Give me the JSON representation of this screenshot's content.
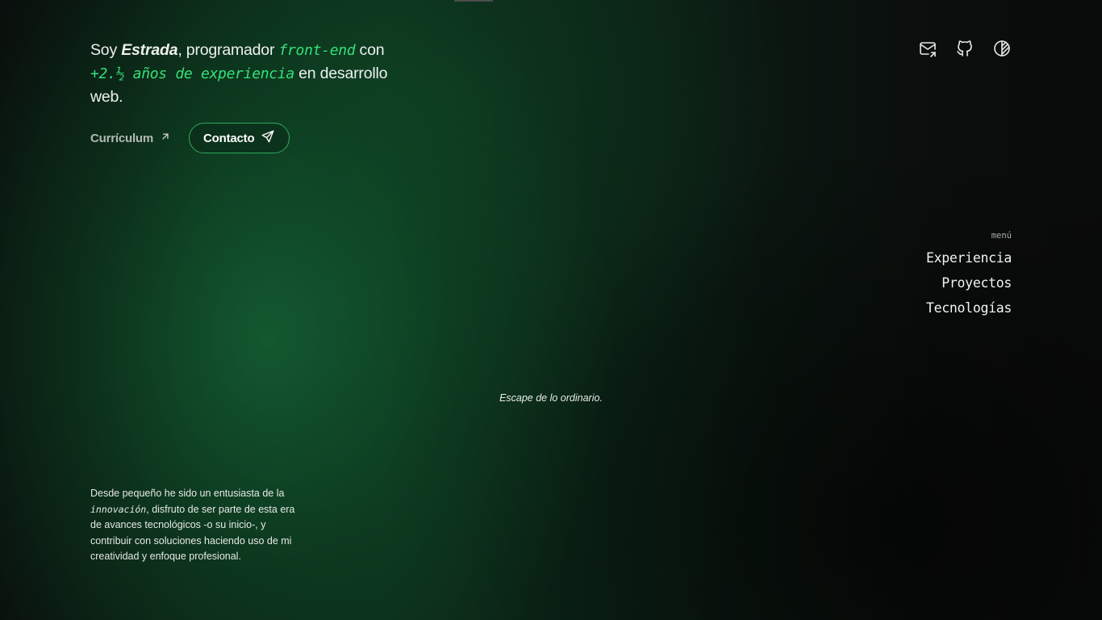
{
  "intro": {
    "prefix": "Soy ",
    "name": "Estrada",
    "after_name": ", programador ",
    "role": "front-end",
    "after_role": " con ",
    "experience": "+2.½ años de experiencia",
    "after_experience": " en desarrollo web."
  },
  "actions": {
    "cv_label": "Currículum",
    "contact_label": "Contacto"
  },
  "social": [
    {
      "icon": "mail-icon"
    },
    {
      "icon": "github-icon"
    },
    {
      "icon": "theme-toggle-icon"
    }
  ],
  "menu": {
    "label": "menú",
    "items": [
      "Experiencia",
      "Proyectos",
      "Tecnologías"
    ]
  },
  "tagline": "Escape de lo ordinario.",
  "bio": {
    "before": "Desde pequeño he sido un entusiasta de la ",
    "highlight": "innovación",
    "after": ", disfruto de ser parte de esta era de avances tecnológicos -o su inicio-, y contribuir con soluciones haciendo uso de mi creatividad y enfoque profesional."
  },
  "colors": {
    "accent": "#37e07a",
    "button_border": "#2fa85c",
    "background": "#0b0d0c"
  }
}
